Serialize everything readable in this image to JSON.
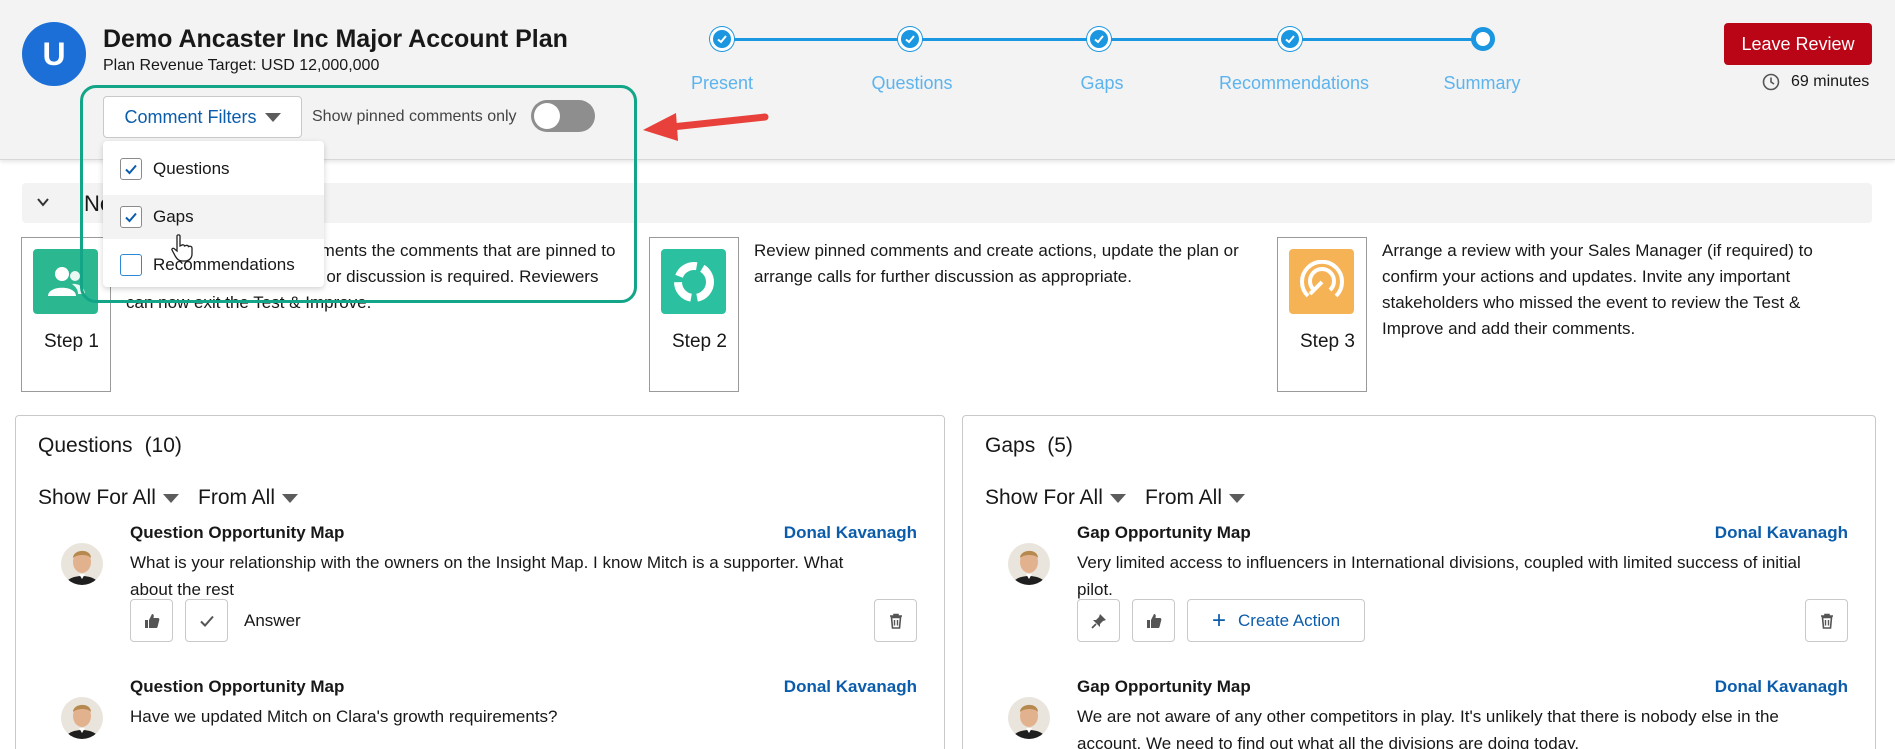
{
  "header": {
    "logo_letter": "U",
    "title": "Demo Ancaster Inc Major Account Plan",
    "subtitle": "Plan Revenue Target: USD 12,000,000",
    "leave_button": "Leave Review",
    "time_remaining": "69 minutes",
    "stepper": [
      "Present",
      "Questions",
      "Gaps",
      "Recommendations",
      "Summary"
    ],
    "current_step": "Summary"
  },
  "filters": {
    "button_label": "Comment Filters",
    "pinned_label": "Show pinned comments only",
    "pinned_only": false,
    "options": [
      {
        "label": "Questions",
        "checked": true
      },
      {
        "label": "Gaps",
        "checked": true
      },
      {
        "label": "Recommendations",
        "checked": false
      }
    ]
  },
  "next_steps": {
    "title": "Next Steps",
    "steps": [
      {
        "label": "Step 1",
        "text": "questions, invite final comments the comments that are pinned to indicate that further action or discussion is required. Reviewers can now exit the Test & Improve."
      },
      {
        "label": "Step 2",
        "text": "Review pinned comments and create actions, update the plan or arrange calls for further discussion as appropriate."
      },
      {
        "label": "Step 3",
        "text": "Arrange a review with your Sales Manager (if required) to confirm your actions and updates. Invite any important stakeholders who missed the event to review the Test & Improve and add their comments."
      }
    ]
  },
  "questions_panel": {
    "title": "Questions",
    "count": "(10)",
    "show_for": "Show For All",
    "from": "From All",
    "items": [
      {
        "type": "Question Opportunity Map",
        "author": "Donal Kavanagh",
        "text": "What is your relationship with the owners on the Insight Map. I know Mitch is a supporter. What about the rest",
        "answer_label": "Answer"
      },
      {
        "type": "Question Opportunity Map",
        "author": "Donal Kavanagh",
        "text": "Have we updated Mitch on Clara's growth requirements?"
      }
    ]
  },
  "gaps_panel": {
    "title": "Gaps",
    "count": "(5)",
    "show_for": "Show For All",
    "from": "From All",
    "items": [
      {
        "type": "Gap Opportunity Map",
        "author": "Donal Kavanagh",
        "text": "Very limited access to influencers in International divisions, coupled with limited success of initial pilot.",
        "create_action_label": "Create Action"
      },
      {
        "type": "Gap Opportunity Map",
        "author": "Donal Kavanagh",
        "text": "We are not aware of any other competitors in play. It's unlikely that there is nobody else in the account. We need to find out what all the divisions are doing today."
      }
    ]
  },
  "colors": {
    "brand_blue": "#1b6fd6",
    "stepper_blue": "#1b96e0",
    "leave_red": "#ba0517",
    "link_blue": "#0b5cab",
    "highlight_green": "#13a588",
    "annotation_arrow": "#e8403a",
    "step1_icon_bg": "#2bb891",
    "step2_icon_bg": "#2bc0a0",
    "step3_icon_bg": "#f6b355"
  },
  "icons": {
    "step1": "people-icon",
    "step2": "refresh-circle-icon",
    "step3": "target-arrow-icon"
  }
}
